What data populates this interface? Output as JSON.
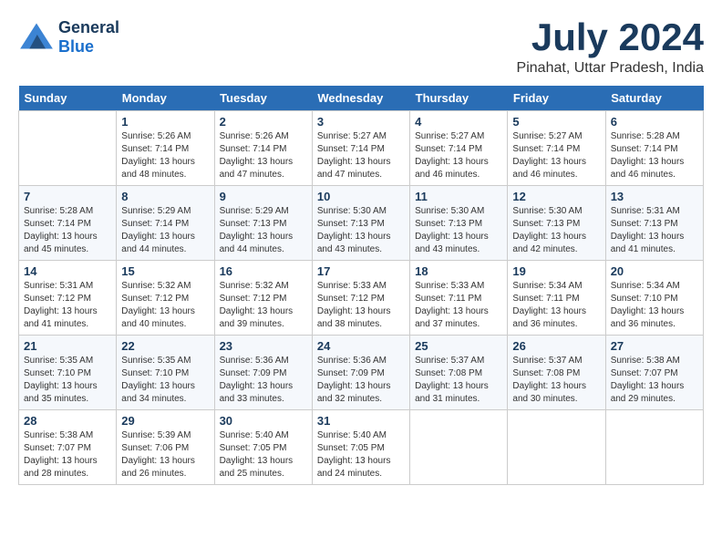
{
  "header": {
    "logo_line1": "General",
    "logo_line2": "Blue",
    "month_year": "July 2024",
    "location": "Pinahat, Uttar Pradesh, India"
  },
  "calendar": {
    "weekdays": [
      "Sunday",
      "Monday",
      "Tuesday",
      "Wednesday",
      "Thursday",
      "Friday",
      "Saturday"
    ],
    "weeks": [
      [
        {
          "day": "",
          "info": ""
        },
        {
          "day": "1",
          "info": "Sunrise: 5:26 AM\nSunset: 7:14 PM\nDaylight: 13 hours\nand 48 minutes."
        },
        {
          "day": "2",
          "info": "Sunrise: 5:26 AM\nSunset: 7:14 PM\nDaylight: 13 hours\nand 47 minutes."
        },
        {
          "day": "3",
          "info": "Sunrise: 5:27 AM\nSunset: 7:14 PM\nDaylight: 13 hours\nand 47 minutes."
        },
        {
          "day": "4",
          "info": "Sunrise: 5:27 AM\nSunset: 7:14 PM\nDaylight: 13 hours\nand 46 minutes."
        },
        {
          "day": "5",
          "info": "Sunrise: 5:27 AM\nSunset: 7:14 PM\nDaylight: 13 hours\nand 46 minutes."
        },
        {
          "day": "6",
          "info": "Sunrise: 5:28 AM\nSunset: 7:14 PM\nDaylight: 13 hours\nand 46 minutes."
        }
      ],
      [
        {
          "day": "7",
          "info": "Sunrise: 5:28 AM\nSunset: 7:14 PM\nDaylight: 13 hours\nand 45 minutes."
        },
        {
          "day": "8",
          "info": "Sunrise: 5:29 AM\nSunset: 7:14 PM\nDaylight: 13 hours\nand 44 minutes."
        },
        {
          "day": "9",
          "info": "Sunrise: 5:29 AM\nSunset: 7:13 PM\nDaylight: 13 hours\nand 44 minutes."
        },
        {
          "day": "10",
          "info": "Sunrise: 5:30 AM\nSunset: 7:13 PM\nDaylight: 13 hours\nand 43 minutes."
        },
        {
          "day": "11",
          "info": "Sunrise: 5:30 AM\nSunset: 7:13 PM\nDaylight: 13 hours\nand 43 minutes."
        },
        {
          "day": "12",
          "info": "Sunrise: 5:30 AM\nSunset: 7:13 PM\nDaylight: 13 hours\nand 42 minutes."
        },
        {
          "day": "13",
          "info": "Sunrise: 5:31 AM\nSunset: 7:13 PM\nDaylight: 13 hours\nand 41 minutes."
        }
      ],
      [
        {
          "day": "14",
          "info": "Sunrise: 5:31 AM\nSunset: 7:12 PM\nDaylight: 13 hours\nand 41 minutes."
        },
        {
          "day": "15",
          "info": "Sunrise: 5:32 AM\nSunset: 7:12 PM\nDaylight: 13 hours\nand 40 minutes."
        },
        {
          "day": "16",
          "info": "Sunrise: 5:32 AM\nSunset: 7:12 PM\nDaylight: 13 hours\nand 39 minutes."
        },
        {
          "day": "17",
          "info": "Sunrise: 5:33 AM\nSunset: 7:12 PM\nDaylight: 13 hours\nand 38 minutes."
        },
        {
          "day": "18",
          "info": "Sunrise: 5:33 AM\nSunset: 7:11 PM\nDaylight: 13 hours\nand 37 minutes."
        },
        {
          "day": "19",
          "info": "Sunrise: 5:34 AM\nSunset: 7:11 PM\nDaylight: 13 hours\nand 36 minutes."
        },
        {
          "day": "20",
          "info": "Sunrise: 5:34 AM\nSunset: 7:10 PM\nDaylight: 13 hours\nand 36 minutes."
        }
      ],
      [
        {
          "day": "21",
          "info": "Sunrise: 5:35 AM\nSunset: 7:10 PM\nDaylight: 13 hours\nand 35 minutes."
        },
        {
          "day": "22",
          "info": "Sunrise: 5:35 AM\nSunset: 7:10 PM\nDaylight: 13 hours\nand 34 minutes."
        },
        {
          "day": "23",
          "info": "Sunrise: 5:36 AM\nSunset: 7:09 PM\nDaylight: 13 hours\nand 33 minutes."
        },
        {
          "day": "24",
          "info": "Sunrise: 5:36 AM\nSunset: 7:09 PM\nDaylight: 13 hours\nand 32 minutes."
        },
        {
          "day": "25",
          "info": "Sunrise: 5:37 AM\nSunset: 7:08 PM\nDaylight: 13 hours\nand 31 minutes."
        },
        {
          "day": "26",
          "info": "Sunrise: 5:37 AM\nSunset: 7:08 PM\nDaylight: 13 hours\nand 30 minutes."
        },
        {
          "day": "27",
          "info": "Sunrise: 5:38 AM\nSunset: 7:07 PM\nDaylight: 13 hours\nand 29 minutes."
        }
      ],
      [
        {
          "day": "28",
          "info": "Sunrise: 5:38 AM\nSunset: 7:07 PM\nDaylight: 13 hours\nand 28 minutes."
        },
        {
          "day": "29",
          "info": "Sunrise: 5:39 AM\nSunset: 7:06 PM\nDaylight: 13 hours\nand 26 minutes."
        },
        {
          "day": "30",
          "info": "Sunrise: 5:40 AM\nSunset: 7:05 PM\nDaylight: 13 hours\nand 25 minutes."
        },
        {
          "day": "31",
          "info": "Sunrise: 5:40 AM\nSunset: 7:05 PM\nDaylight: 13 hours\nand 24 minutes."
        },
        {
          "day": "",
          "info": ""
        },
        {
          "day": "",
          "info": ""
        },
        {
          "day": "",
          "info": ""
        }
      ]
    ]
  }
}
